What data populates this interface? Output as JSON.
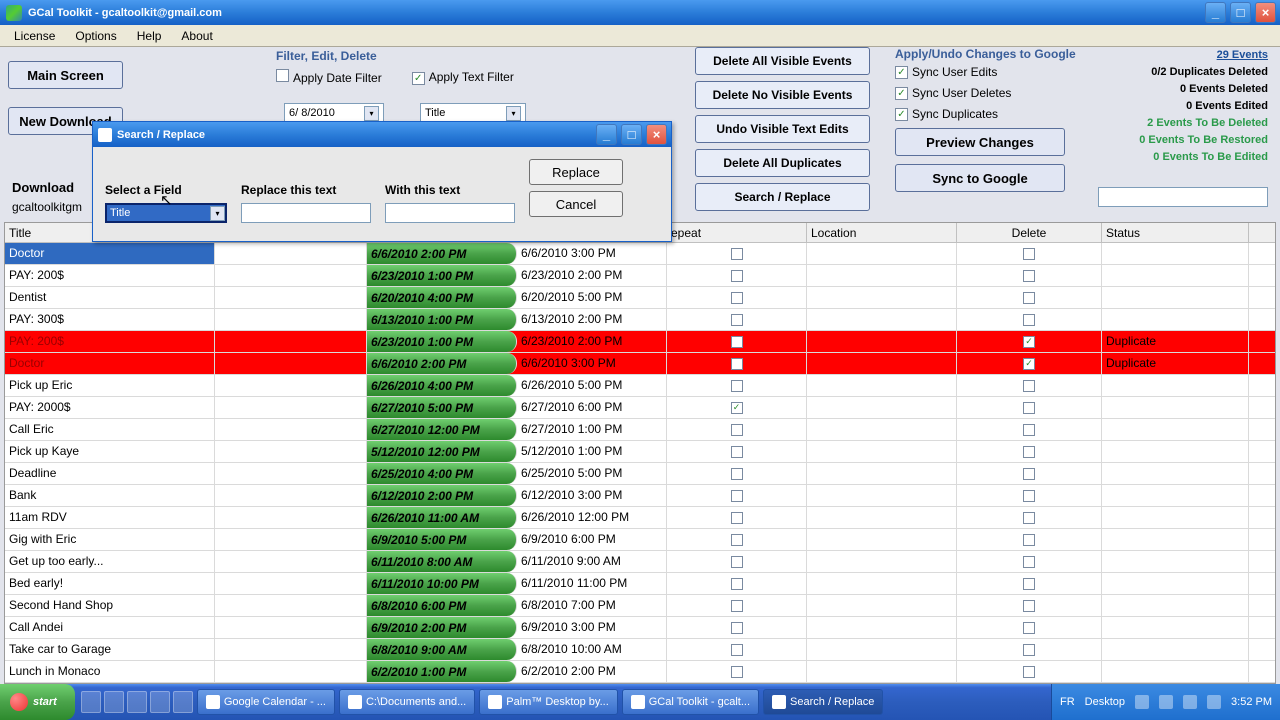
{
  "window": {
    "title": "GCal Toolkit - gcaltoolkit@gmail.com"
  },
  "menu": {
    "license": "License",
    "options": "Options",
    "help": "Help",
    "about": "About"
  },
  "left": {
    "main": "Main Screen",
    "newdown": "New Download",
    "download": "Download",
    "email": "gcaltoolkitgm"
  },
  "filter": {
    "title": "Filter, Edit, Delete",
    "apply_date": "Apply Date Filter",
    "apply_text": "Apply Text Filter",
    "date_value": "6/ 8/2010",
    "field_value": "Title"
  },
  "rbuttons": {
    "del_vis": "Delete All Visible Events",
    "del_novis": "Delete No Visible Events",
    "undo_vis": "Undo Visible Text Edits",
    "del_dup": "Delete All Duplicates",
    "search": "Search / Replace"
  },
  "sync": {
    "title": "Apply/Undo Changes to Google",
    "user_edits": "Sync User Edits",
    "user_deletes": "Sync User Deletes",
    "duplicates": "Sync Duplicates",
    "preview": "Preview Changes",
    "sync": "Sync to Google"
  },
  "stats": {
    "events": "29 Events",
    "dup": "0/2 Duplicates Deleted",
    "evdel": "0 Events Deleted",
    "eved": "0 Events Edited",
    "tobedel": "2 Events To Be Deleted",
    "restored": "0 Events To Be Restored",
    "tobeed": "0 Events To Be Edited"
  },
  "headers": {
    "title": "Title",
    "start": "",
    "end": "",
    "repeat": "epeat",
    "location": "Location",
    "delete": "Delete",
    "status": "Status"
  },
  "rows": [
    {
      "title": "Doctor",
      "start": "6/6/2010 2:00 PM",
      "end": "6/6/2010 3:00 PM",
      "rep": false,
      "del": false,
      "status": "",
      "sel": true,
      "dup": false
    },
    {
      "title": "PAY: 200$",
      "start": "6/23/2010 1:00 PM",
      "end": "6/23/2010 2:00 PM",
      "rep": false,
      "del": false,
      "status": "",
      "sel": false,
      "dup": false
    },
    {
      "title": "Dentist",
      "start": "6/20/2010 4:00 PM",
      "end": "6/20/2010 5:00 PM",
      "rep": false,
      "del": false,
      "status": "",
      "sel": false,
      "dup": false
    },
    {
      "title": "PAY: 300$",
      "start": "6/13/2010 1:00 PM",
      "end": "6/13/2010 2:00 PM",
      "rep": false,
      "del": false,
      "status": "",
      "sel": false,
      "dup": false
    },
    {
      "title": "PAY: 200$",
      "start": "6/23/2010 1:00 PM",
      "end": "6/23/2010 2:00 PM",
      "rep": false,
      "del": true,
      "status": "Duplicate",
      "sel": false,
      "dup": true
    },
    {
      "title": "Doctor",
      "start": "6/6/2010 2:00 PM",
      "end": "6/6/2010 3:00 PM",
      "rep": false,
      "del": true,
      "status": "Duplicate",
      "sel": false,
      "dup": true
    },
    {
      "title": "Pick up Eric",
      "start": "6/26/2010 4:00 PM",
      "end": "6/26/2010 5:00 PM",
      "rep": false,
      "del": false,
      "status": "",
      "sel": false,
      "dup": false
    },
    {
      "title": "PAY: 2000$",
      "start": "6/27/2010 5:00 PM",
      "end": "6/27/2010 6:00 PM",
      "rep": true,
      "del": false,
      "status": "",
      "sel": false,
      "dup": false
    },
    {
      "title": "Call Eric",
      "start": "6/27/2010 12:00 PM",
      "end": "6/27/2010 1:00 PM",
      "rep": false,
      "del": false,
      "status": "",
      "sel": false,
      "dup": false
    },
    {
      "title": "Pick up Kaye",
      "start": "5/12/2010 12:00 PM",
      "end": "5/12/2010 1:00 PM",
      "rep": false,
      "del": false,
      "status": "",
      "sel": false,
      "dup": false
    },
    {
      "title": "Deadline",
      "start": "6/25/2010 4:00 PM",
      "end": "6/25/2010 5:00 PM",
      "rep": false,
      "del": false,
      "status": "",
      "sel": false,
      "dup": false
    },
    {
      "title": "Bank",
      "start": "6/12/2010 2:00 PM",
      "end": "6/12/2010 3:00 PM",
      "rep": false,
      "del": false,
      "status": "",
      "sel": false,
      "dup": false
    },
    {
      "title": "11am RDV",
      "start": "6/26/2010 11:00 AM",
      "end": "6/26/2010 12:00 PM",
      "rep": false,
      "del": false,
      "status": "",
      "sel": false,
      "dup": false
    },
    {
      "title": "Gig with Eric",
      "start": "6/9/2010 5:00 PM",
      "end": "6/9/2010 6:00 PM",
      "rep": false,
      "del": false,
      "status": "",
      "sel": false,
      "dup": false
    },
    {
      "title": "Get up too early...",
      "start": "6/11/2010 8:00 AM",
      "end": "6/11/2010 9:00 AM",
      "rep": false,
      "del": false,
      "status": "",
      "sel": false,
      "dup": false
    },
    {
      "title": "Bed early!",
      "start": "6/11/2010 10:00 PM",
      "end": "6/11/2010 11:00 PM",
      "rep": false,
      "del": false,
      "status": "",
      "sel": false,
      "dup": false
    },
    {
      "title": "Second Hand Shop",
      "start": "6/8/2010 6:00 PM",
      "end": "6/8/2010 7:00 PM",
      "rep": false,
      "del": false,
      "status": "",
      "sel": false,
      "dup": false
    },
    {
      "title": "Call Andei",
      "start": "6/9/2010 2:00 PM",
      "end": "6/9/2010 3:00 PM",
      "rep": false,
      "del": false,
      "status": "",
      "sel": false,
      "dup": false
    },
    {
      "title": "Take car to Garage",
      "start": "6/8/2010 9:00 AM",
      "end": "6/8/2010 10:00 AM",
      "rep": false,
      "del": false,
      "status": "",
      "sel": false,
      "dup": false
    },
    {
      "title": "Lunch in Monaco",
      "start": "6/2/2010 1:00 PM",
      "end": "6/2/2010 2:00 PM",
      "rep": false,
      "del": false,
      "status": "",
      "sel": false,
      "dup": false
    }
  ],
  "dialog": {
    "title": "Search / Replace",
    "select_field": "Select a Field",
    "field_value": "Title",
    "replace_this": "Replace this text",
    "with_this": "With this text",
    "replace": "Replace",
    "cancel": "Cancel"
  },
  "taskbar": {
    "start": "start",
    "t1": "Google Calendar - ...",
    "t2": "C:\\Documents and...",
    "t3": "Palm™ Desktop by...",
    "t4": "GCal Toolkit - gcalt...",
    "t5": "Search / Replace",
    "lang": "FR",
    "desktop": "Desktop",
    "time": "3:52 PM"
  }
}
